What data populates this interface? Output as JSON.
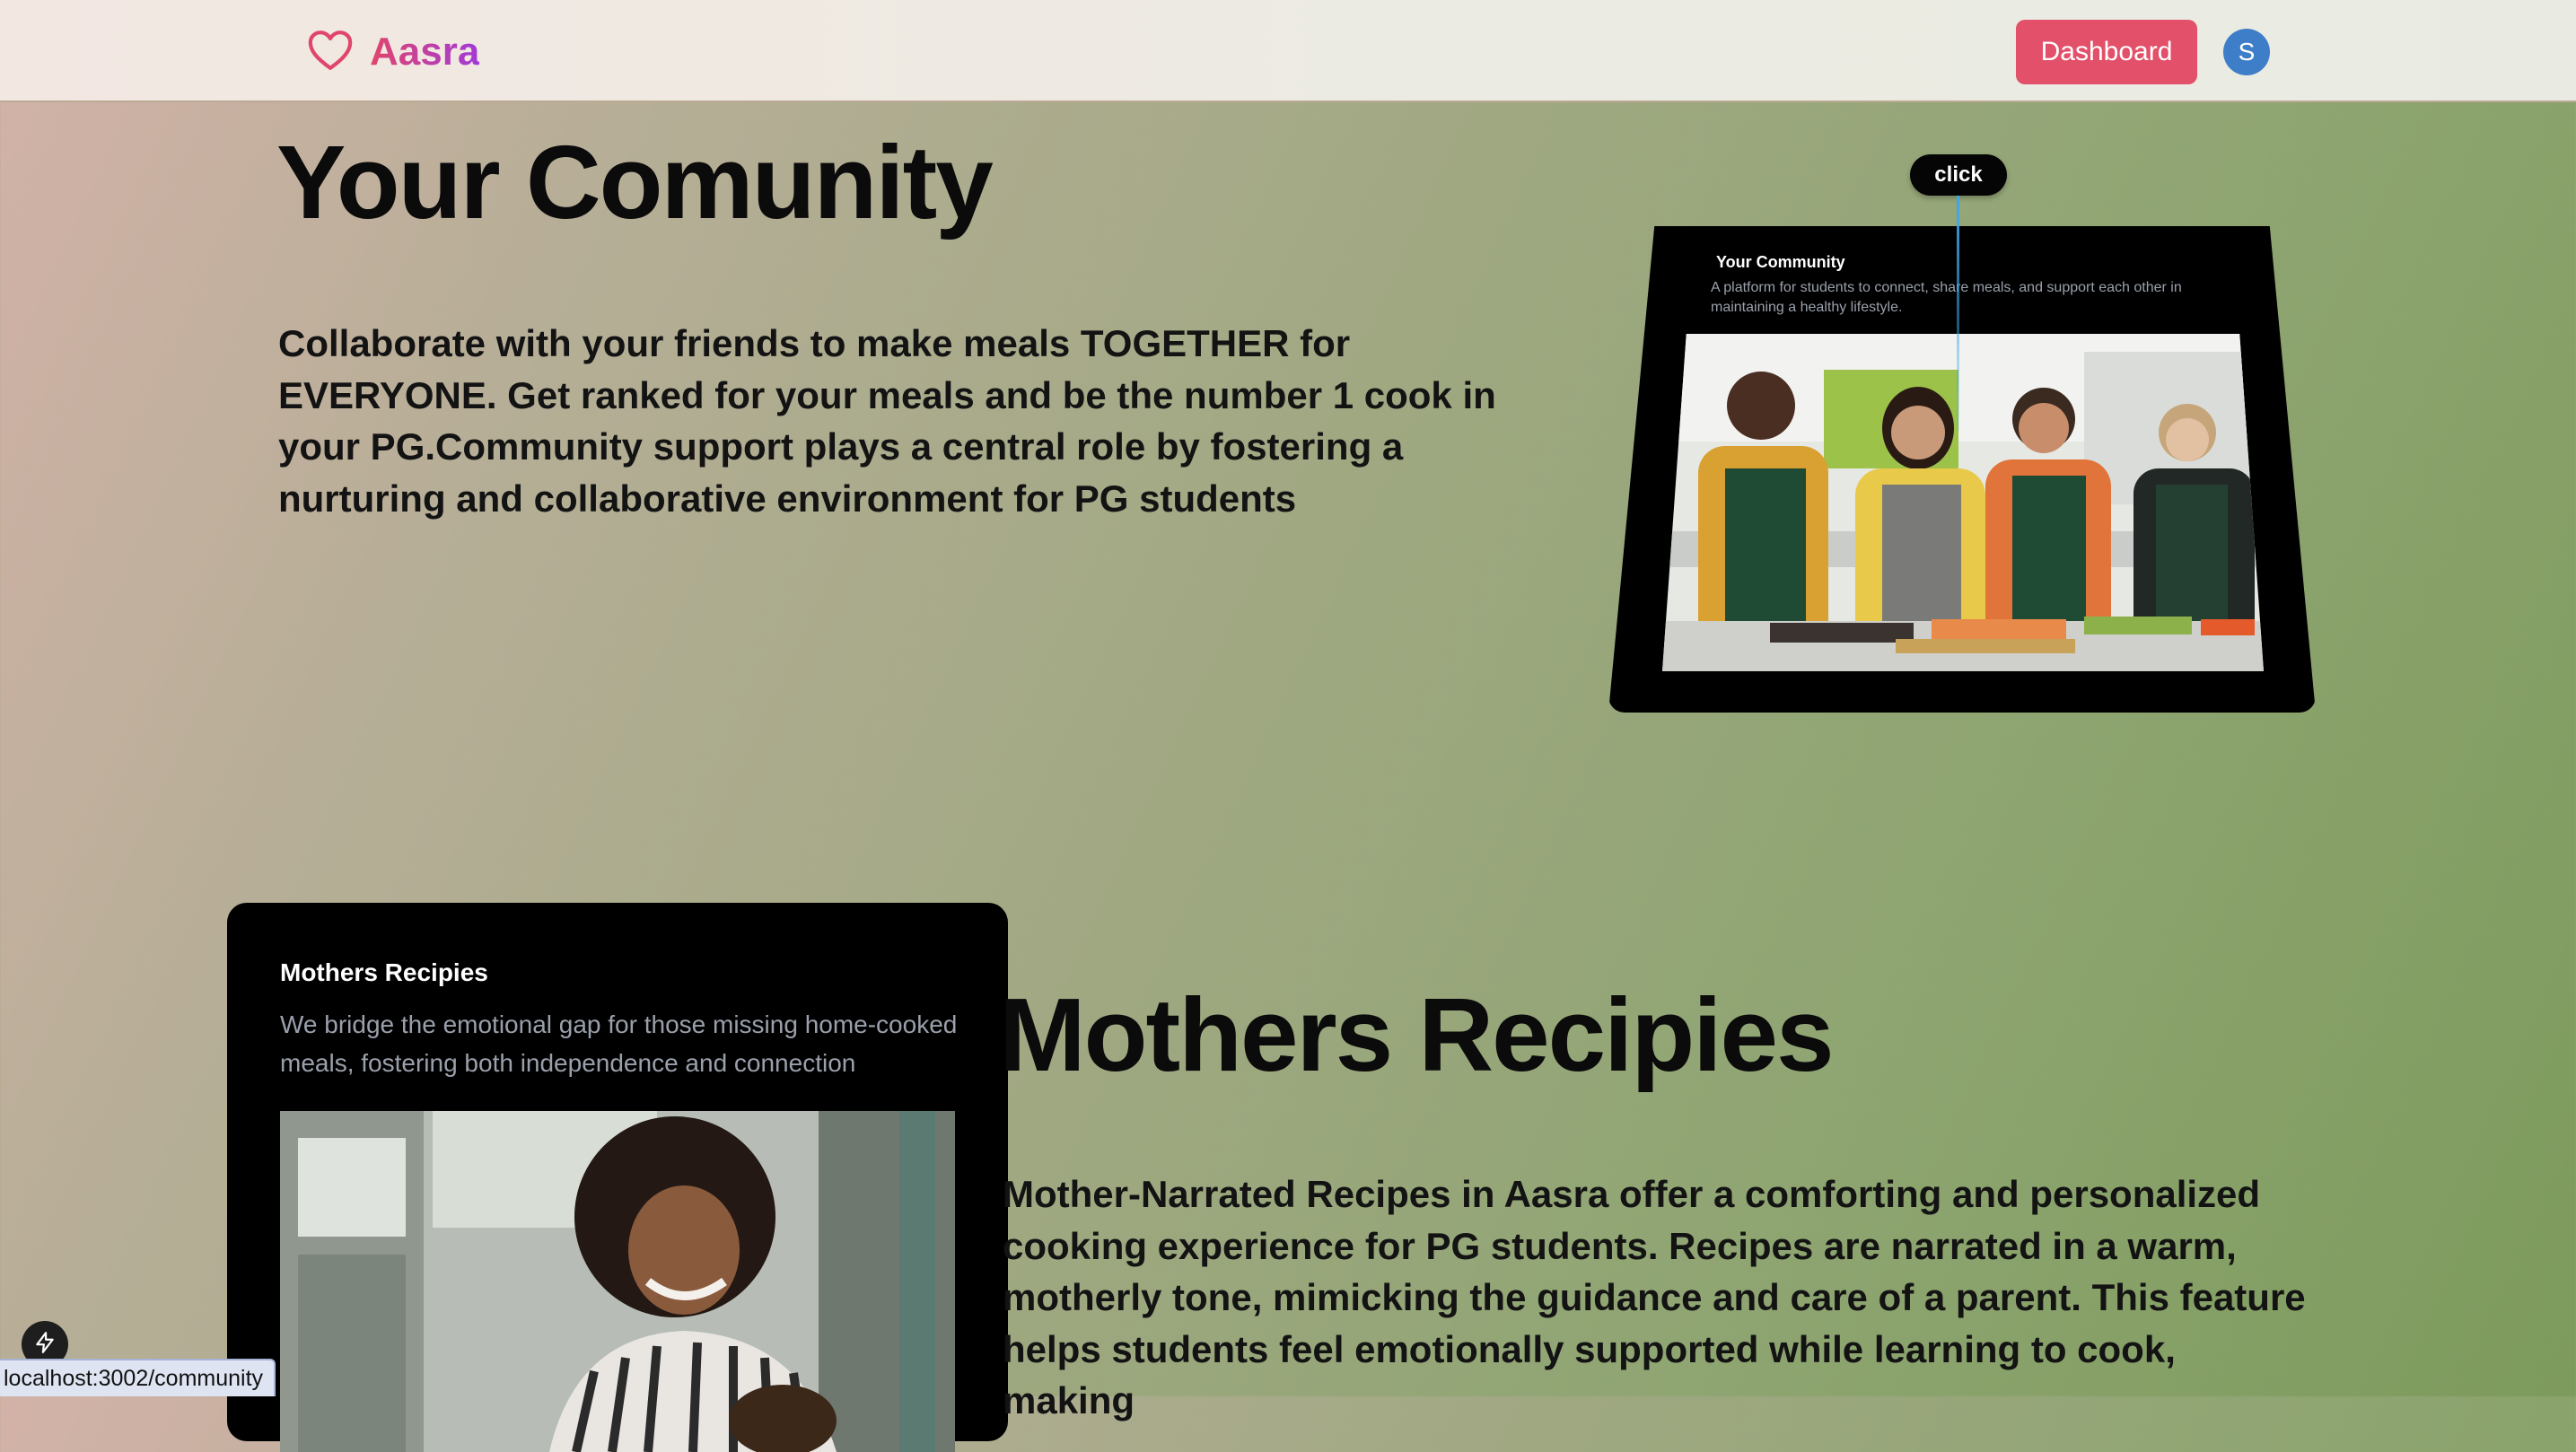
{
  "navbar": {
    "brand_name": "Aasra",
    "dashboard_label": "Dashboard",
    "avatar_initial": "S"
  },
  "community_section": {
    "title": "Your Comunity",
    "description": "Collaborate with your friends to make meals TOGETHER for EVERYONE. Get ranked for your meals and be the number 1 cook in your PG.Community support plays a central role by fostering a nurturing and collaborative environment for PG students",
    "click_chip": "click",
    "card": {
      "title": "Your Community",
      "description": "A platform for students to connect, share meals, and support each other in maintaining a healthy lifestyle."
    }
  },
  "mothers_section": {
    "card": {
      "title": "Mothers Recipies",
      "description": "We bridge the emotional gap for those missing home-cooked meals, fostering both independence and connection"
    },
    "title": "Mothers Recipies",
    "description": "Mother-Narrated Recipes in Aasra offer a comforting and personalized cooking experience for PG students. Recipes are narrated in a warm, motherly tone, mimicking the guidance and care of a parent. This feature helps students feel emotionally supported while learning to cook, making"
  },
  "browser": {
    "status_url": "localhost:3002/community"
  },
  "icons": {
    "brand": "heart-icon",
    "dev_indicator": "lightning-icon"
  },
  "colors": {
    "brand_gradient_start": "#e0466c",
    "brand_gradient_end": "#a23ad8",
    "dashboard_button": "#e2506a",
    "avatar": "#3e7ec8",
    "card_background": "#000000"
  }
}
